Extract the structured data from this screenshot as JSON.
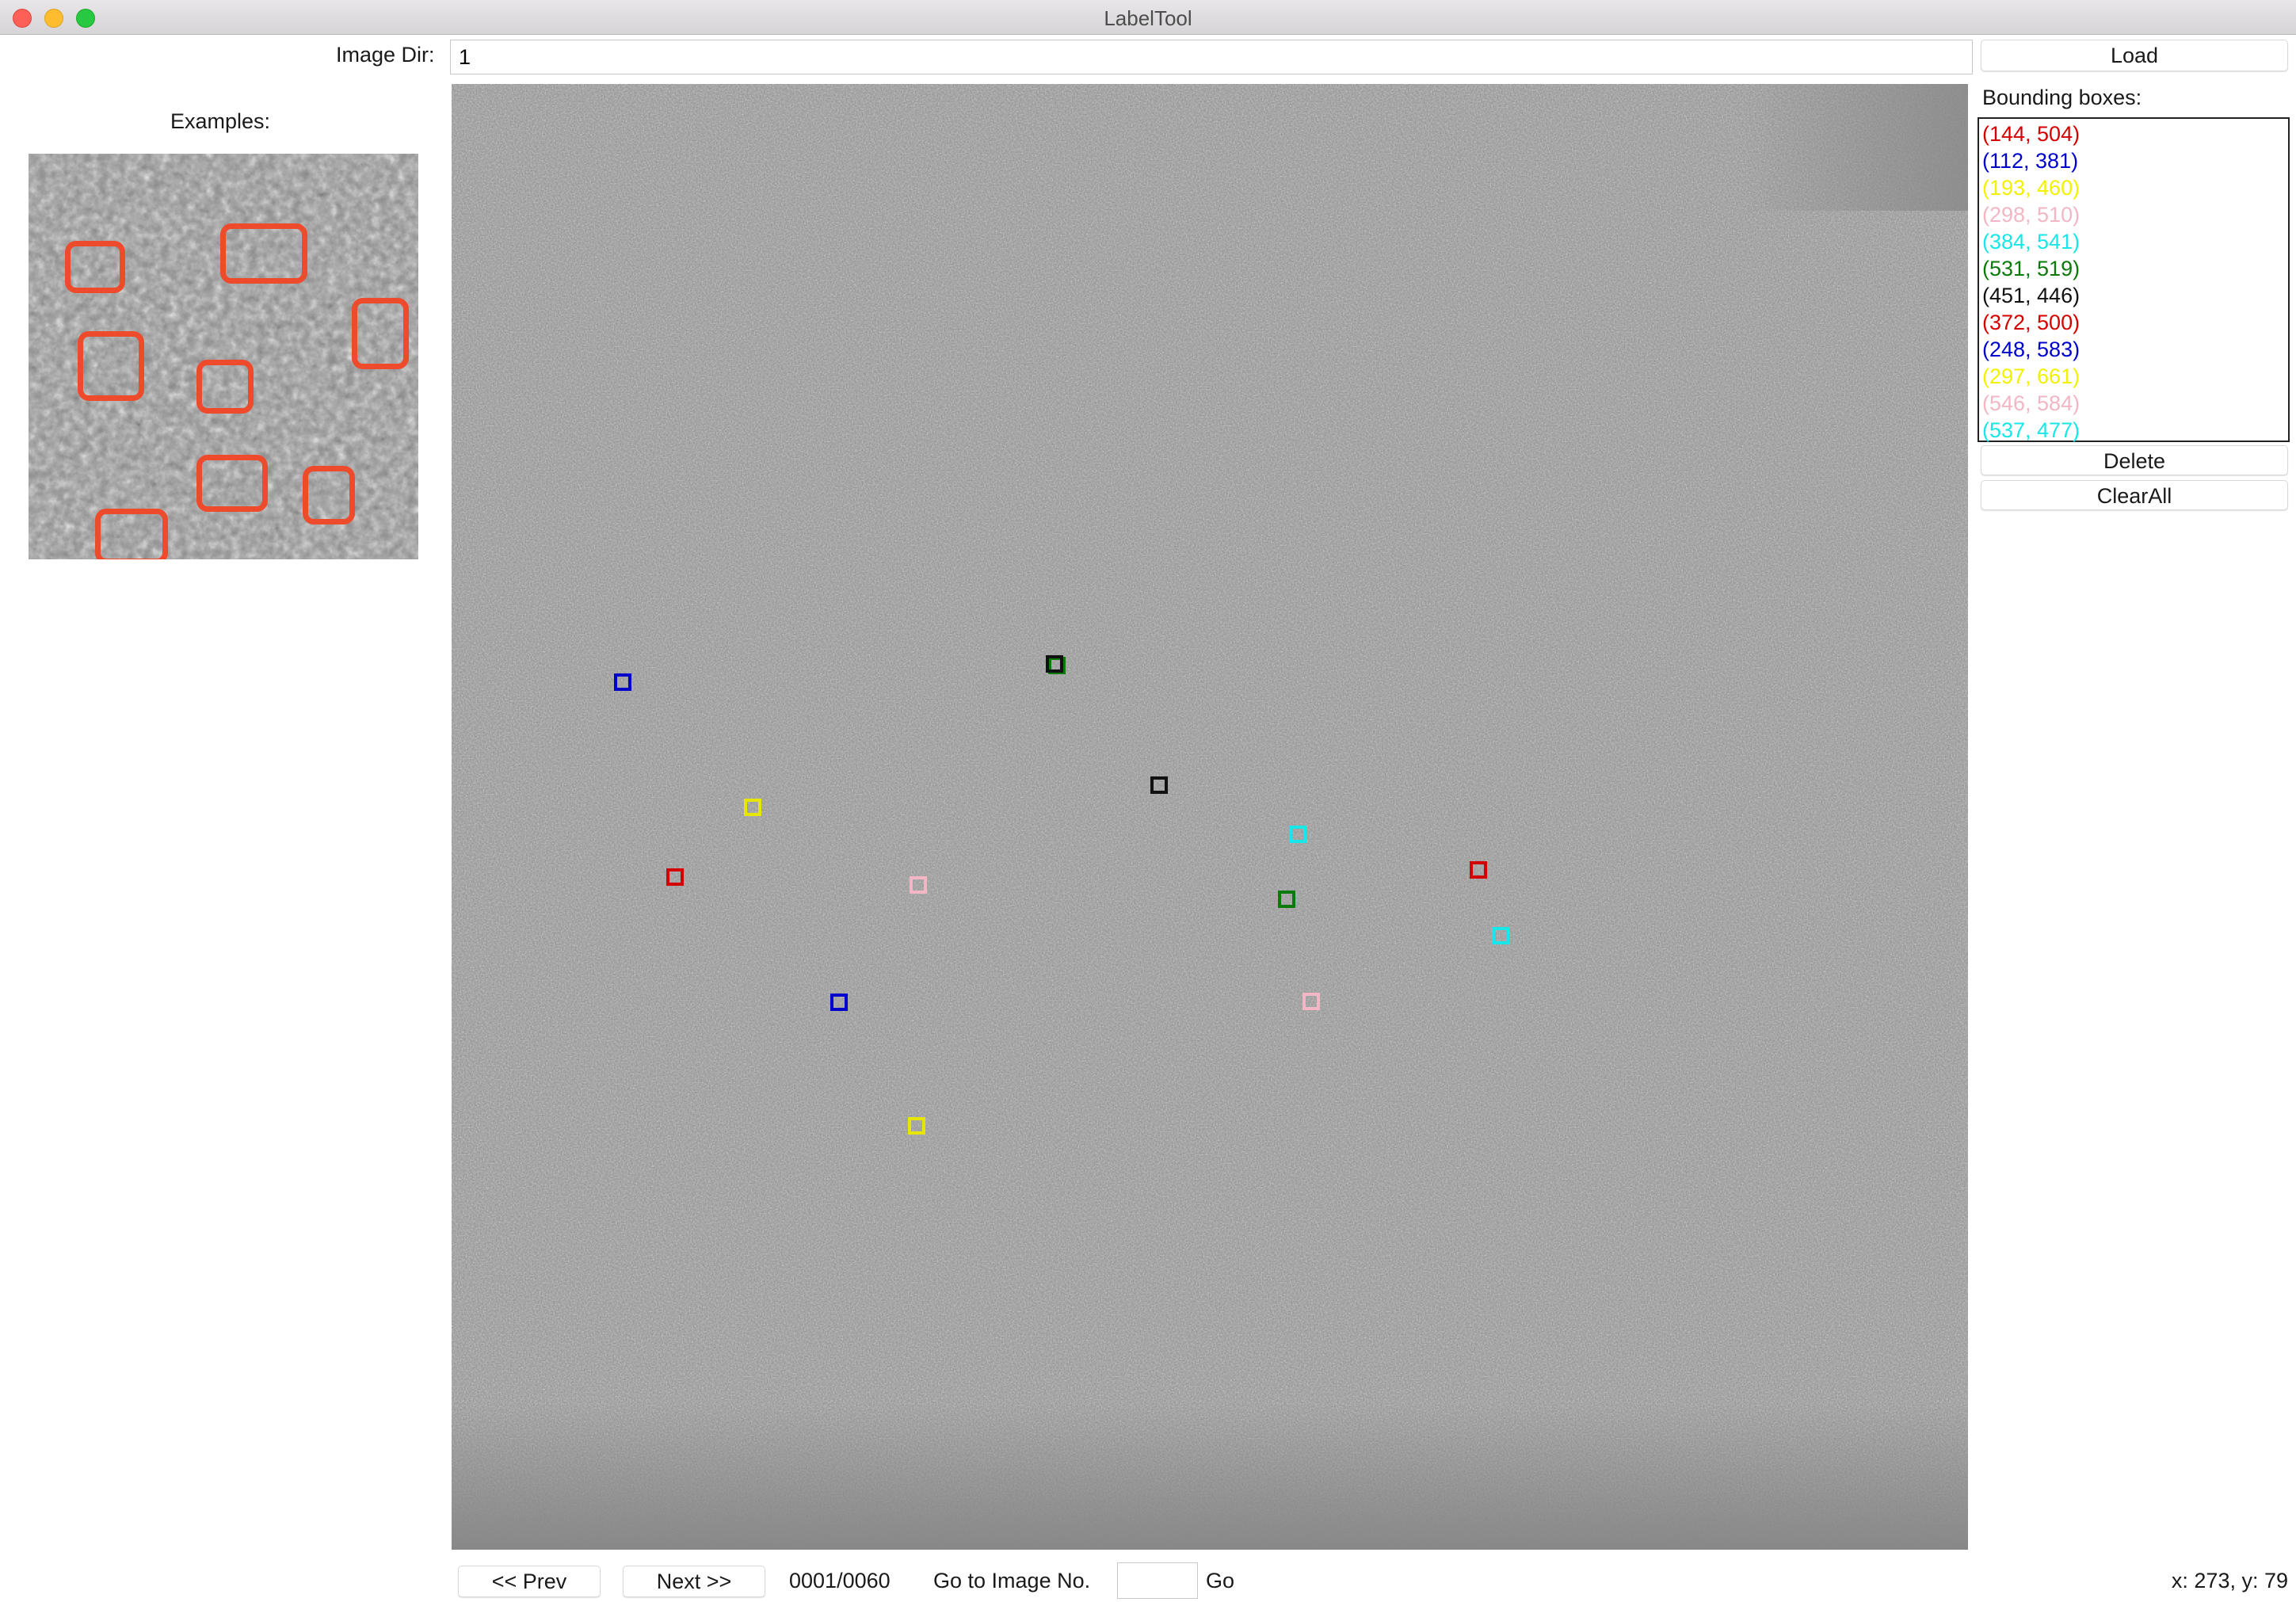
{
  "window": {
    "title": "LabelTool"
  },
  "toolbar": {
    "image_dir_label": "Image Dir:",
    "image_dir_value": "1",
    "load_label": "Load"
  },
  "examples": {
    "label": "Examples:",
    "box_color": "#ee4a2c"
  },
  "bounding_boxes": {
    "label": "Bounding boxes:",
    "items": [
      {
        "text": "(144, 504)",
        "color": "#d40000"
      },
      {
        "text": "(112, 381)",
        "color": "#0000cc"
      },
      {
        "text": "(193, 460)",
        "color": "#f2f200"
      },
      {
        "text": "(298, 510)",
        "color": "#f2b6c4"
      },
      {
        "text": "(384, 541)",
        "color": "#19e6e6"
      },
      {
        "text": "(531, 519)",
        "color": "#0a7a0a"
      },
      {
        "text": "(451, 446)",
        "color": "#111111"
      },
      {
        "text": "(372, 500)",
        "color": "#d40000"
      },
      {
        "text": "(248, 583)",
        "color": "#0000cc"
      },
      {
        "text": "(297, 661)",
        "color": "#f2f200"
      },
      {
        "text": "(546, 584)",
        "color": "#f2b6c4"
      },
      {
        "text": "(537, 477)",
        "color": "#19e6e6"
      }
    ],
    "delete_label": "Delete",
    "clear_label": "ClearAll"
  },
  "navigation": {
    "prev_label": "<< Prev",
    "next_label": "Next >>",
    "progress": "0001/0060",
    "goto_label": "Go to Image No.",
    "goto_value": "",
    "go_label": "Go"
  },
  "status": {
    "cursor": "x: 273, y: 79"
  }
}
